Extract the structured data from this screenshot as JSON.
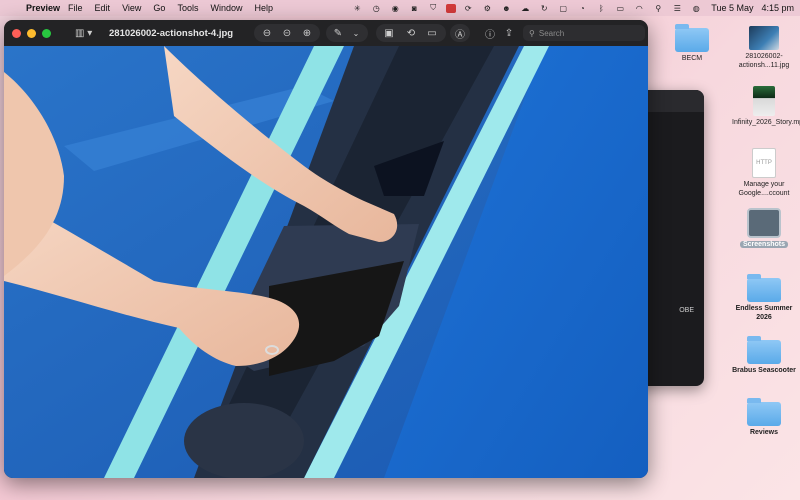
{
  "menubar": {
    "app_name": "Preview",
    "menus": [
      "File",
      "Edit",
      "View",
      "Go",
      "Tools",
      "Window",
      "Help"
    ],
    "date": "Tue 5 May",
    "time": "4:15 pm"
  },
  "window": {
    "title": "281026002-actionshot-4.jpg",
    "search_placeholder": "Search"
  },
  "desktop": {
    "items": [
      {
        "label": "BECM",
        "kind": "folder"
      },
      {
        "label": "281026002-actionsh...11.jpg",
        "kind": "image"
      },
      {
        "label": "Infinity_2026_Story.mp4",
        "kind": "video"
      },
      {
        "label": "Manage your Google....ccount",
        "kind": "document"
      },
      {
        "label": "Screenshots",
        "kind": "folder-selected"
      },
      {
        "label": "Endless Summer 2026",
        "kind": "folder"
      },
      {
        "label": "Brabus Seascooter",
        "kind": "folder"
      },
      {
        "label": "Reviews",
        "kind": "folder"
      },
      {
        "label": "OBE",
        "kind": "partial"
      }
    ]
  },
  "colors": {
    "desktop_pink": "#f3c6d2",
    "window_bg": "#1e1e1e",
    "folder_blue": "#5aaae9",
    "board_blue": "#1f6fcf",
    "stripe_teal": "#8fe3e6"
  }
}
